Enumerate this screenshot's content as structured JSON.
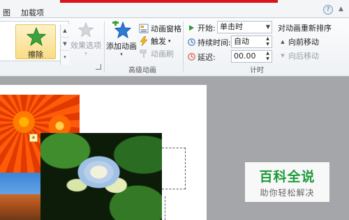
{
  "tabs": {
    "partial": "图",
    "addins": "加载项"
  },
  "gallery": {
    "selected_label": "擦除"
  },
  "effect_options": {
    "label": "效果选项"
  },
  "advanced_animation": {
    "add_animation_label": "添加动画",
    "animation_pane_label": "动画窗格",
    "trigger_label": "触发",
    "animation_painter_label": "动画刷",
    "group_label": "高级动画"
  },
  "timing": {
    "start_label": "开始:",
    "start_value": "单击时",
    "duration_label": "持续时间:",
    "duration_value": "自动",
    "delay_label": "延迟:",
    "delay_value": "00.00",
    "group_label": "计时"
  },
  "reorder": {
    "title": "对动画重新排序",
    "move_earlier": "向前移动",
    "move_later": "向后移动"
  },
  "watermark": {
    "title": "百科全说",
    "subtitle": "助你轻松解决"
  },
  "colors": {
    "accent_red": "#d9141a",
    "watermark_green": "#1c9b3a"
  }
}
